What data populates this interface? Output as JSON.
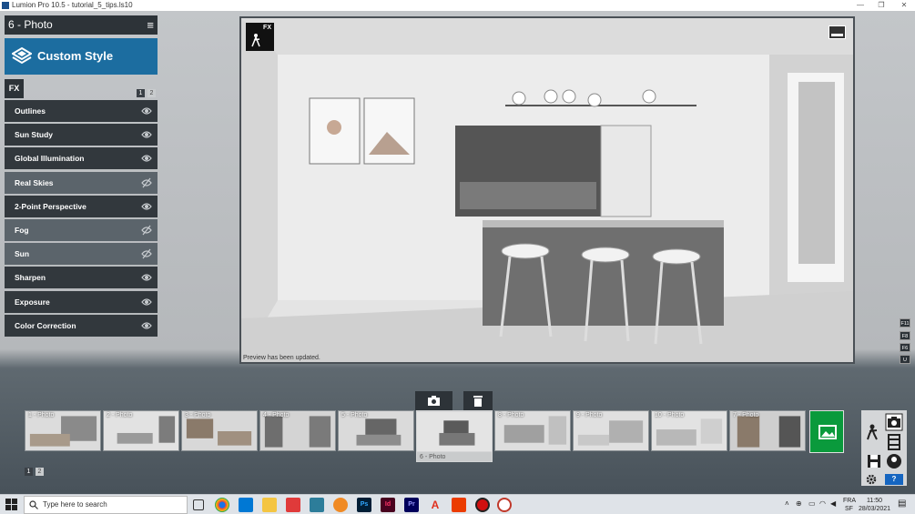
{
  "window": {
    "title": "Lumion Pro 10.5 - tutorial_5_tips.ls10",
    "minimize": "—",
    "maximize": "❐",
    "close": "✕"
  },
  "left_panel": {
    "photo_title": "6 - Photo",
    "menu_icon": "≡",
    "style_label": "Custom Style",
    "fx_tab": "FX",
    "pages": [
      "1",
      "2"
    ],
    "effects": [
      {
        "label": "Outlines",
        "enabled": true
      },
      {
        "label": "Sun Study",
        "enabled": true
      },
      {
        "label": "Global Illumination",
        "enabled": true
      },
      {
        "label": "Real Skies",
        "enabled": false
      },
      {
        "label": "2-Point Perspective",
        "enabled": true
      },
      {
        "label": "Fog",
        "enabled": false
      },
      {
        "label": "Sun",
        "enabled": false
      },
      {
        "label": "Sharpen",
        "enabled": true
      },
      {
        "label": "Exposure",
        "enabled": true
      },
      {
        "label": "Color Correction",
        "enabled": true
      }
    ]
  },
  "preview": {
    "fx_badge": "FX",
    "status": "Preview has been updated."
  },
  "key_hints": [
    "F11",
    "F8",
    "F6",
    "U"
  ],
  "photos": [
    "1 - Photo",
    "2 - Photo",
    "3 - Photo",
    "4 - Photo",
    "5 - Photo",
    "6 - Photo",
    "8 - Photo",
    "9 - Photo",
    "10 - Photo",
    "7 - Photo"
  ],
  "photos_pages": [
    "1",
    "2"
  ],
  "mode_panel": {
    "help": "?"
  },
  "taskbar": {
    "search_placeholder": "Type here to search",
    "lang": "FRA",
    "lang_sub": "SF",
    "time": "11:50",
    "date": "28/03/2021",
    "apps": [
      "task-view",
      "chrome",
      "mail",
      "explorer",
      "red-app",
      "blue-app",
      "blender",
      "Ps",
      "Id",
      "Pr",
      "A",
      "office",
      "record",
      "lumion"
    ]
  },
  "colors": {
    "accent": "#1c6da0",
    "panel": "#32383d",
    "add_photo": "#0a9a3c"
  }
}
